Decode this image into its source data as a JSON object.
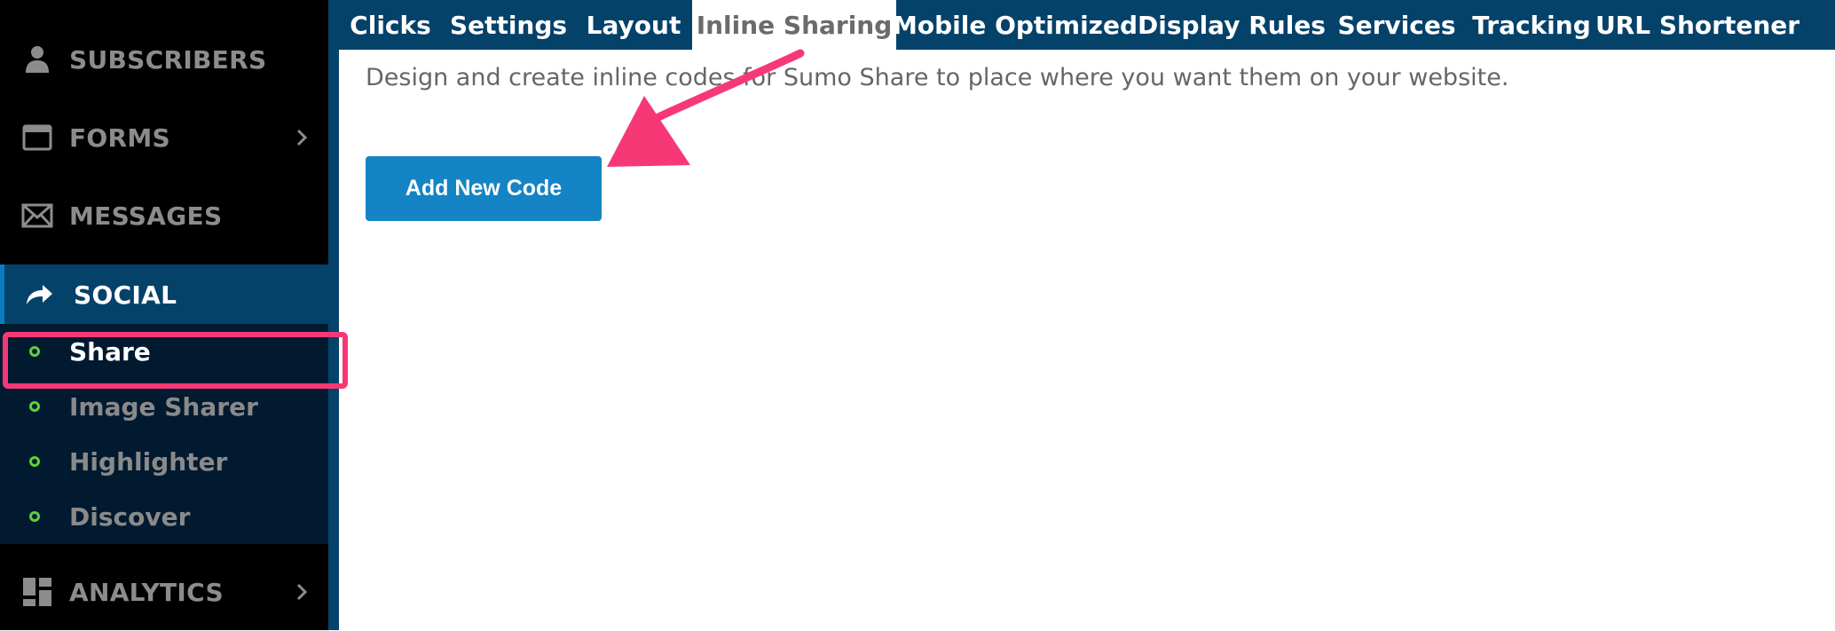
{
  "sidebar": {
    "items": [
      {
        "label": "SUBSCRIBERS",
        "icon": "user-icon"
      },
      {
        "label": "FORMS",
        "icon": "window-icon",
        "has_chevron": true
      },
      {
        "label": "MESSAGES",
        "icon": "envelope-icon"
      },
      {
        "label": "SOCIAL",
        "icon": "share-arrow-icon",
        "active": true
      },
      {
        "label": "ANALYTICS",
        "icon": "dashboard-grid-icon",
        "has_chevron": true
      }
    ],
    "social_submenu": [
      {
        "label": "Share",
        "active": true
      },
      {
        "label": "Image Sharer"
      },
      {
        "label": "Highlighter"
      },
      {
        "label": "Discover"
      }
    ]
  },
  "tabs": [
    {
      "label": "Clicks"
    },
    {
      "label": "Settings"
    },
    {
      "label": "Layout"
    },
    {
      "label": "Inline Sharing",
      "active": true
    },
    {
      "label": "Mobile Optimized"
    },
    {
      "label": "Display Rules"
    },
    {
      "label": "Services"
    },
    {
      "label": "Tracking"
    },
    {
      "label": "URL Shortener"
    }
  ],
  "content": {
    "description": "Design and create inline codes for Sumo Share to place where you want them on your website.",
    "add_button_label": "Add New Code"
  },
  "colors": {
    "sidebar_bg": "#000000",
    "submenu_bg": "#021a30",
    "navy": "#05426a",
    "button_blue": "#1484c4",
    "annotation_pink": "#f73876",
    "status_green": "#5fd03a"
  }
}
